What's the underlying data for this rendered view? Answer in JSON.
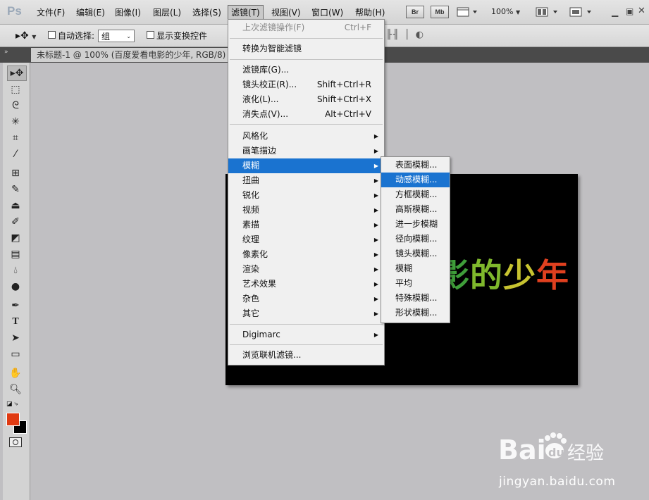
{
  "app": {
    "logo": "Ps"
  },
  "menubar": {
    "items": [
      "文件(F)",
      "编辑(E)",
      "图像(I)",
      "图层(L)",
      "选择(S)",
      "滤镜(T)",
      "视图(V)",
      "窗口(W)",
      "帮助(H)"
    ],
    "badges": [
      "Br",
      "Mb"
    ],
    "zoom": "100%"
  },
  "options": {
    "auto_select_label": "自动选择:",
    "auto_select_value": "组",
    "show_transform_label": "显示变换控件"
  },
  "document": {
    "tab_title": "未标题-1 @ 100% (百度爱看电影的少年, RGB/8)"
  },
  "canvas": {
    "visible_text": [
      {
        "text": "影",
        "color": "#3f9e3a"
      },
      {
        "text": "的",
        "color": "#7fb82c"
      },
      {
        "text": "少",
        "color": "#c7c330"
      },
      {
        "text": "年",
        "color": "#e0401f"
      }
    ]
  },
  "filter_menu": {
    "last_filter": "上次滤镜操作(F)",
    "last_filter_shortcut": "Ctrl+F",
    "convert_smart": "转换为智能滤镜",
    "gallery": "滤镜库(G)...",
    "lens": "镜头校正(R)...",
    "lens_shortcut": "Shift+Ctrl+R",
    "liquify": "液化(L)...",
    "liquify_shortcut": "Shift+Ctrl+X",
    "vanish": "消失点(V)...",
    "vanish_shortcut": "Alt+Ctrl+V",
    "submenus": [
      "风格化",
      "画笔描边",
      "模糊",
      "扭曲",
      "锐化",
      "视频",
      "素描",
      "纹理",
      "像素化",
      "渲染",
      "艺术效果",
      "杂色",
      "其它"
    ],
    "digimarc": "Digimarc",
    "browse_online": "浏览联机滤镜..."
  },
  "blur_menu": {
    "items": [
      "表面模糊...",
      "动感模糊...",
      "方框模糊...",
      "高斯模糊...",
      "进一步模糊",
      "径向模糊...",
      "镜头模糊...",
      "模糊",
      "平均",
      "特殊模糊...",
      "形状模糊..."
    ],
    "highlighted_index": 1
  },
  "colors": {
    "foreground": "#e03a12",
    "background": "#000000",
    "highlight": "#1a73d0"
  },
  "watermark": {
    "brand": "Baidu经验",
    "url": "jingyan.baidu.com"
  }
}
